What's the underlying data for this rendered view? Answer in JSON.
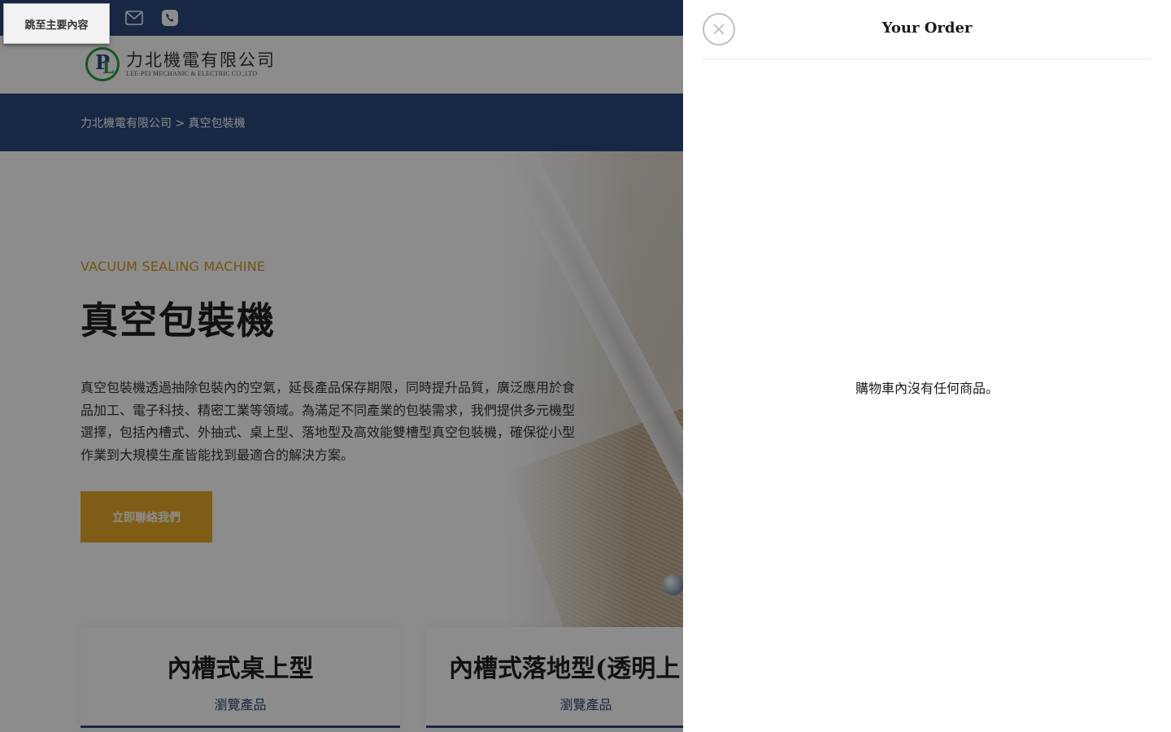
{
  "topbar": {
    "skip_link": "跳至主要內容",
    "mail_icon": "mail-icon",
    "phone_icon": "phone-icon"
  },
  "logo": {
    "mark": "LP",
    "name_cn": "力北機電有限公司",
    "name_en": "LEE-PEI MECHANIC & ELECTRIC CO.,LTD"
  },
  "breadcrumb": {
    "home": "力北機電有限公司",
    "separator": " > ",
    "current": "真空包裝機"
  },
  "hero": {
    "eyebrow": "VACUUM SEALING MACHINE",
    "title": "真空包裝機",
    "description": "真空包裝機透過抽除包裝內的空氣，延長產品保存期限，同時提升品質，廣泛應用於食品加工、電子科技、精密工業等領域。為滿足不同產業的包裝需求，我們提供多元機型選擇，包括內槽式、外抽式、桌上型、落地型及高效能雙槽型真空包裝機，確保從小型作業到大規模生產皆能找到最適合的解決方案。",
    "cta_label": "立即聯絡我們"
  },
  "cards": [
    {
      "title": "內槽式桌上型",
      "link": "瀏覽產品"
    },
    {
      "title": "內槽式落地型(透明上",
      "link": "瀏覽產品"
    }
  ],
  "cart": {
    "title": "Your Order",
    "empty_message": "購物車內沒有任何商品。",
    "close_icon": "close-icon"
  },
  "colors": {
    "brand_blue": "#2a4a7f",
    "accent_gold": "#e7a92a",
    "eyebrow_gold": "#d39a1f",
    "logo_green": "#2f9a4b"
  }
}
